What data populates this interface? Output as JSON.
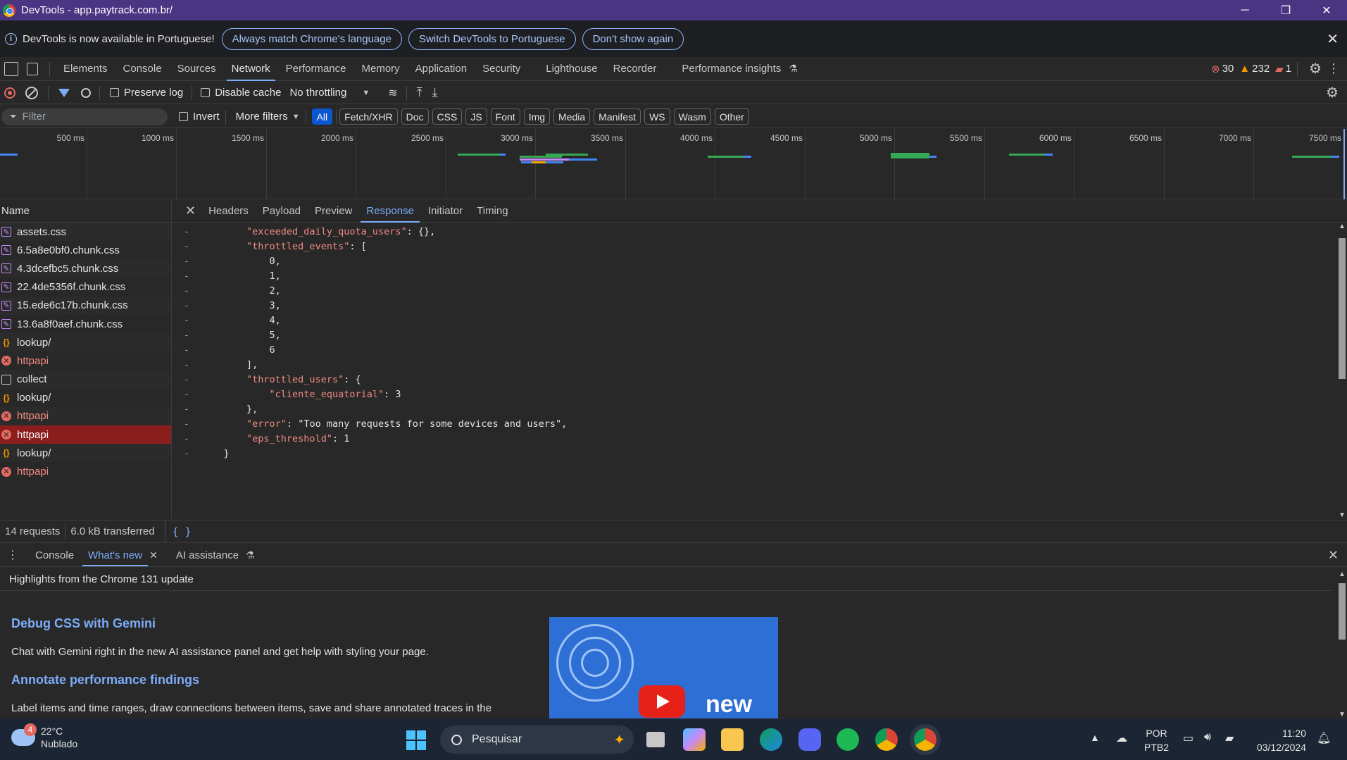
{
  "window": {
    "title": "DevTools - app.paytrack.com.br/",
    "min": "─",
    "restore": "❐",
    "close": "✕"
  },
  "infobar": {
    "message": "DevTools is now available in Portuguese!",
    "buttons": [
      "Always match Chrome's language",
      "Switch DevTools to Portuguese",
      "Don't show again"
    ],
    "close": "✕"
  },
  "main_tabs": [
    "Elements",
    "Console",
    "Sources",
    "Network",
    "Performance",
    "Memory",
    "Application",
    "Security",
    "Lighthouse",
    "Recorder",
    "Performance insights"
  ],
  "main_tabs_active": "Network",
  "counts": {
    "errors": "30",
    "warnings": "232",
    "issues": "1"
  },
  "network_toolbar": {
    "preserve_log": "Preserve log",
    "disable_cache": "Disable cache",
    "throttling": "No throttling"
  },
  "filter": {
    "placeholder": "Filter",
    "invert": "Invert",
    "more_filters": "More filters",
    "types": [
      "All",
      "Fetch/XHR",
      "Doc",
      "CSS",
      "JS",
      "Font",
      "Img",
      "Media",
      "Manifest",
      "WS",
      "Wasm",
      "Other"
    ],
    "active_type": "All"
  },
  "overview": {
    "ticks": [
      "500 ms",
      "1000 ms",
      "1500 ms",
      "2000 ms",
      "2500 ms",
      "3000 ms",
      "3500 ms",
      "4000 ms",
      "4500 ms",
      "5000 ms",
      "5500 ms",
      "6000 ms",
      "6500 ms",
      "7000 ms",
      "7500 ms"
    ]
  },
  "request_list": {
    "header": "Name",
    "items": [
      {
        "name": "assets.css",
        "type": "css"
      },
      {
        "name": "6.5a8e0bf0.chunk.css",
        "type": "css"
      },
      {
        "name": "4.3dcefbc5.chunk.css",
        "type": "css"
      },
      {
        "name": "22.4de5356f.chunk.css",
        "type": "css"
      },
      {
        "name": "15.ede6c17b.chunk.css",
        "type": "css"
      },
      {
        "name": "13.6a8f0aef.chunk.css",
        "type": "css"
      },
      {
        "name": "lookup/",
        "type": "json"
      },
      {
        "name": "httpapi",
        "type": "error"
      },
      {
        "name": "collect",
        "type": "doc"
      },
      {
        "name": "lookup/",
        "type": "json"
      },
      {
        "name": "httpapi",
        "type": "error"
      },
      {
        "name": "httpapi",
        "type": "error-selected"
      },
      {
        "name": "lookup/",
        "type": "json"
      },
      {
        "name": "httpapi",
        "type": "error"
      }
    ]
  },
  "detail_tabs": [
    "Headers",
    "Payload",
    "Preview",
    "Response",
    "Initiator",
    "Timing"
  ],
  "detail_active": "Response",
  "response_lines": [
    "        \"exceeded_daily_quota_users\": {},",
    "        \"throttled_events\": [",
    "            0,",
    "            1,",
    "            2,",
    "            3,",
    "            4,",
    "            5,",
    "            6",
    "        ],",
    "        \"throttled_users\": {",
    "            \"cliente_equatorial\": 3",
    "        },",
    "        \"error\": \"Too many requests for some devices and users\",",
    "        \"eps_threshold\": 1",
    "    }"
  ],
  "status": {
    "requests": "14 requests",
    "transferred": "6.0 kB transferred",
    "pretty": "{ }"
  },
  "drawer": {
    "tabs": [
      "Console",
      "What's new",
      "AI assistance"
    ],
    "active": "What's new",
    "highlight": "Highlights from the Chrome 131 update",
    "sections": [
      {
        "title": "Debug CSS with Gemini",
        "text": "Chat with Gemini right in the new AI assistance panel and get help with styling your page."
      },
      {
        "title": "Annotate performance findings",
        "text": "Label items and time ranges, draw connections between items, save and share annotated traces in the"
      }
    ],
    "video_text": "new"
  },
  "taskbar": {
    "weather_temp": "22°C",
    "weather_desc": "Nublado",
    "weather_badge": "4",
    "search_placeholder": "Pesquisar",
    "lang1": "POR",
    "lang2": "PTB2",
    "time": "11:20",
    "date": "03/12/2024"
  }
}
